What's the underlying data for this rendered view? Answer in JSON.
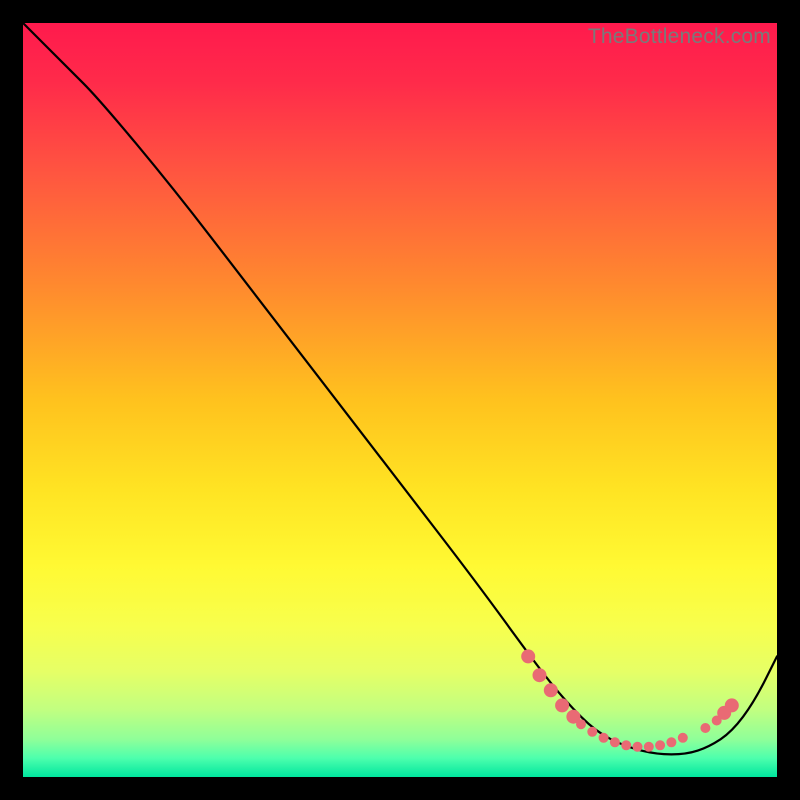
{
  "watermark": "TheBottleneck.com",
  "gradient_stops": [
    {
      "offset": 0.0,
      "color": "#ff1a4d"
    },
    {
      "offset": 0.08,
      "color": "#ff2b4a"
    },
    {
      "offset": 0.2,
      "color": "#ff5640"
    },
    {
      "offset": 0.35,
      "color": "#ff8a2e"
    },
    {
      "offset": 0.5,
      "color": "#ffc21e"
    },
    {
      "offset": 0.62,
      "color": "#ffe423"
    },
    {
      "offset": 0.72,
      "color": "#fff933"
    },
    {
      "offset": 0.8,
      "color": "#f7ff4d"
    },
    {
      "offset": 0.86,
      "color": "#e6ff66"
    },
    {
      "offset": 0.91,
      "color": "#c2ff80"
    },
    {
      "offset": 0.95,
      "color": "#8fff99"
    },
    {
      "offset": 0.975,
      "color": "#4dffad"
    },
    {
      "offset": 1.0,
      "color": "#00e69e"
    }
  ],
  "chart_data": {
    "type": "line",
    "title": "",
    "xlabel": "",
    "ylabel": "",
    "xlim": [
      0,
      100
    ],
    "ylim": [
      0,
      100
    ],
    "series": [
      {
        "name": "bottleneck-curve",
        "color": "#000000",
        "x": [
          0,
          6,
          10,
          20,
          30,
          40,
          50,
          60,
          68,
          72,
          76,
          80,
          84,
          88,
          91,
          94,
          97,
          100
        ],
        "y": [
          100,
          94,
          90,
          78,
          65,
          52,
          39,
          26,
          15,
          10,
          6,
          4,
          3,
          3,
          4,
          6,
          10,
          16
        ]
      }
    ],
    "markers": {
      "name": "highlight-cluster",
      "color": "#e96a74",
      "radius_large": 7,
      "radius_small": 5,
      "points": [
        {
          "x": 67.0,
          "y": 16.0,
          "r": "large"
        },
        {
          "x": 68.5,
          "y": 13.5,
          "r": "large"
        },
        {
          "x": 70.0,
          "y": 11.5,
          "r": "large"
        },
        {
          "x": 71.5,
          "y": 9.5,
          "r": "large"
        },
        {
          "x": 73.0,
          "y": 8.0,
          "r": "large"
        },
        {
          "x": 74.0,
          "y": 7.0,
          "r": "small"
        },
        {
          "x": 75.5,
          "y": 6.0,
          "r": "small"
        },
        {
          "x": 77.0,
          "y": 5.2,
          "r": "small"
        },
        {
          "x": 78.5,
          "y": 4.6,
          "r": "small"
        },
        {
          "x": 80.0,
          "y": 4.2,
          "r": "small"
        },
        {
          "x": 81.5,
          "y": 4.0,
          "r": "small"
        },
        {
          "x": 83.0,
          "y": 4.0,
          "r": "small"
        },
        {
          "x": 84.5,
          "y": 4.2,
          "r": "small"
        },
        {
          "x": 86.0,
          "y": 4.6,
          "r": "small"
        },
        {
          "x": 87.5,
          "y": 5.2,
          "r": "small"
        },
        {
          "x": 90.5,
          "y": 6.5,
          "r": "small"
        },
        {
          "x": 92.0,
          "y": 7.5,
          "r": "small"
        },
        {
          "x": 93.0,
          "y": 8.5,
          "r": "large"
        },
        {
          "x": 94.0,
          "y": 9.5,
          "r": "large"
        }
      ]
    }
  }
}
